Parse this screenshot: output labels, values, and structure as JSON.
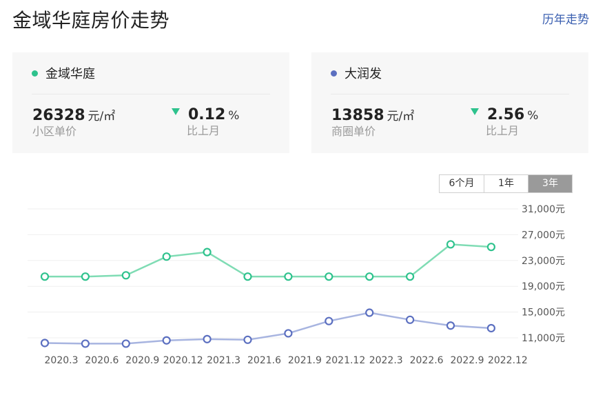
{
  "header": {
    "title": "金域华庭房价走势",
    "history_link": "历年走势"
  },
  "cards": [
    {
      "name": "金域华庭",
      "color": "#2ec28d",
      "price": "26328",
      "price_unit": "元/㎡",
      "price_label": "小区单价",
      "change": "0.12",
      "change_unit": "%",
      "change_label": "比上月",
      "trend_icon": "triangle-down-icon"
    },
    {
      "name": "大润发",
      "color": "#5b6fc0",
      "price": "13858",
      "price_unit": "元/㎡",
      "price_label": "商圈单价",
      "change": "2.56",
      "change_unit": "%",
      "change_label": "比上月",
      "trend_icon": "triangle-down-icon"
    }
  ],
  "range_tabs": [
    "6个月",
    "1年",
    "3年"
  ],
  "active_range": "3年",
  "chart_data": {
    "type": "line",
    "x": [
      "2020.3",
      "2020.6",
      "2020.9",
      "2020.12",
      "2021.3",
      "2021.6",
      "2021.9",
      "2021.12",
      "2022.3",
      "2022.6",
      "2022.9",
      "2022.12"
    ],
    "y_ticks": [
      "31,000元",
      "27,000元",
      "23,000元",
      "19,000元",
      "15,000元",
      "11,000元"
    ],
    "ylim": [
      11000,
      31000
    ],
    "grid": true,
    "series": [
      {
        "name": "金域华庭",
        "color": "#2ec28d",
        "line_color": "#7fdcb4",
        "values": [
          20500,
          20500,
          20700,
          23600,
          24300,
          20500,
          20500,
          20500,
          20500,
          20500,
          25500,
          25100
        ]
      },
      {
        "name": "大润发",
        "color": "#5b6fc0",
        "line_color": "#a7b4e0",
        "values": [
          10200,
          10100,
          10100,
          10600,
          10800,
          10700,
          11700,
          13600,
          14900,
          13800,
          12900,
          12500
        ]
      }
    ]
  }
}
